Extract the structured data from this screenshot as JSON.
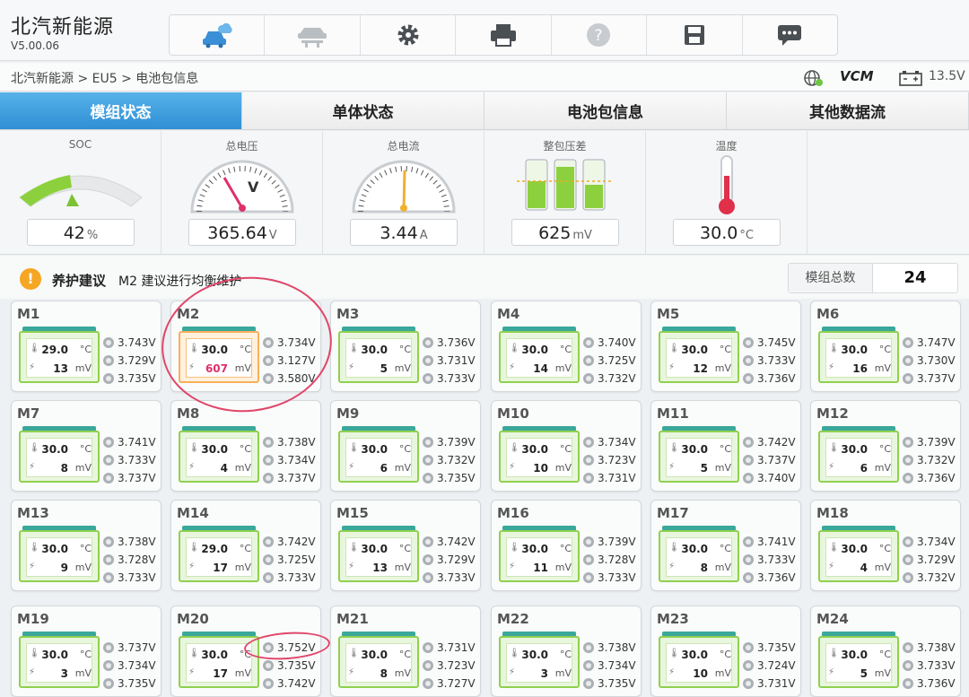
{
  "app": {
    "title": "北汽新能源",
    "version": "V5.00.06"
  },
  "toolbar": {
    "items": [
      {
        "icon": "car-diagnosis-icon"
      },
      {
        "icon": "car-lift-icon"
      },
      {
        "icon": "gear-icon"
      },
      {
        "icon": "printer-icon"
      },
      {
        "icon": "help-icon"
      },
      {
        "icon": "save-icon"
      },
      {
        "icon": "message-icon"
      }
    ]
  },
  "breadcrumb": "北汽新能源 > EU5 > 电池包信息",
  "status": {
    "vcm": "VCM",
    "voltage": "13.5V"
  },
  "tabs": [
    "模组状态",
    "单体状态",
    "电池包信息",
    "其他数据流"
  ],
  "gauges": [
    {
      "title": "SOC",
      "value": "42",
      "unit": "%"
    },
    {
      "title": "总电压",
      "value": "365.64",
      "unit": "V"
    },
    {
      "title": "总电流",
      "value": "3.44",
      "unit": "A"
    },
    {
      "title": "整包压差",
      "value": "625",
      "unit": "mV"
    },
    {
      "title": "温度",
      "value": "30.0",
      "unit": "°C"
    }
  ],
  "soc_level": 0.42,
  "advice": {
    "title": "养护建议",
    "text": "M2 建议进行均衡维护"
  },
  "total": {
    "label": "模组总数",
    "value": "24"
  },
  "temp_unit": "°C",
  "diff_unit": "mV",
  "modules": [
    {
      "name": "M1",
      "temp": "29.0",
      "diff": "13",
      "v1": "3.743V",
      "v2": "3.729V",
      "v3": "3.735V"
    },
    {
      "name": "M2",
      "temp": "30.0",
      "diff": "607",
      "v1": "3.734V",
      "v2": "3.127V",
      "v3": "3.580V",
      "warn": true
    },
    {
      "name": "M3",
      "temp": "30.0",
      "diff": "5",
      "v1": "3.736V",
      "v2": "3.731V",
      "v3": "3.733V"
    },
    {
      "name": "M4",
      "temp": "30.0",
      "diff": "14",
      "v1": "3.740V",
      "v2": "3.725V",
      "v3": "3.732V"
    },
    {
      "name": "M5",
      "temp": "30.0",
      "diff": "12",
      "v1": "3.745V",
      "v2": "3.733V",
      "v3": "3.736V"
    },
    {
      "name": "M6",
      "temp": "30.0",
      "diff": "16",
      "v1": "3.747V",
      "v2": "3.730V",
      "v3": "3.737V"
    },
    {
      "name": "M7",
      "temp": "30.0",
      "diff": "8",
      "v1": "3.741V",
      "v2": "3.733V",
      "v3": "3.737V"
    },
    {
      "name": "M8",
      "temp": "30.0",
      "diff": "4",
      "v1": "3.738V",
      "v2": "3.734V",
      "v3": "3.737V"
    },
    {
      "name": "M9",
      "temp": "30.0",
      "diff": "6",
      "v1": "3.739V",
      "v2": "3.732V",
      "v3": "3.735V"
    },
    {
      "name": "M10",
      "temp": "30.0",
      "diff": "10",
      "v1": "3.734V",
      "v2": "3.723V",
      "v3": "3.731V"
    },
    {
      "name": "M11",
      "temp": "30.0",
      "diff": "5",
      "v1": "3.742V",
      "v2": "3.737V",
      "v3": "3.740V"
    },
    {
      "name": "M12",
      "temp": "30.0",
      "diff": "6",
      "v1": "3.739V",
      "v2": "3.732V",
      "v3": "3.736V"
    },
    {
      "name": "M13",
      "temp": "30.0",
      "diff": "9",
      "v1": "3.738V",
      "v2": "3.728V",
      "v3": "3.733V"
    },
    {
      "name": "M14",
      "temp": "29.0",
      "diff": "17",
      "v1": "3.742V",
      "v2": "3.725V",
      "v3": "3.733V"
    },
    {
      "name": "M15",
      "temp": "30.0",
      "diff": "13",
      "v1": "3.742V",
      "v2": "3.729V",
      "v3": "3.733V"
    },
    {
      "name": "M16",
      "temp": "30.0",
      "diff": "11",
      "v1": "3.739V",
      "v2": "3.728V",
      "v3": "3.733V"
    },
    {
      "name": "M17",
      "temp": "30.0",
      "diff": "8",
      "v1": "3.741V",
      "v2": "3.733V",
      "v3": "3.736V"
    },
    {
      "name": "M18",
      "temp": "30.0",
      "diff": "4",
      "v1": "3.734V",
      "v2": "3.729V",
      "v3": "3.732V"
    },
    {
      "name": "M19",
      "temp": "30.0",
      "diff": "3",
      "v1": "3.737V",
      "v2": "3.734V",
      "v3": "3.735V"
    },
    {
      "name": "M20",
      "temp": "30.0",
      "diff": "17",
      "v1": "3.752V",
      "v2": "3.735V",
      "v3": "3.742V"
    },
    {
      "name": "M21",
      "temp": "30.0",
      "diff": "8",
      "v1": "3.731V",
      "v2": "3.723V",
      "v3": "3.727V"
    },
    {
      "name": "M22",
      "temp": "30.0",
      "diff": "3",
      "v1": "3.738V",
      "v2": "3.734V",
      "v3": "3.735V"
    },
    {
      "name": "M23",
      "temp": "30.0",
      "diff": "10",
      "v1": "3.735V",
      "v2": "3.724V",
      "v3": "3.731V"
    },
    {
      "name": "M24",
      "temp": "30.0",
      "diff": "5",
      "v1": "3.738V",
      "v2": "3.733V",
      "v3": "3.736V"
    }
  ],
  "colors": {
    "accent": "#3498db",
    "alert": "#e0306a",
    "annotation": "#e0466a"
  }
}
